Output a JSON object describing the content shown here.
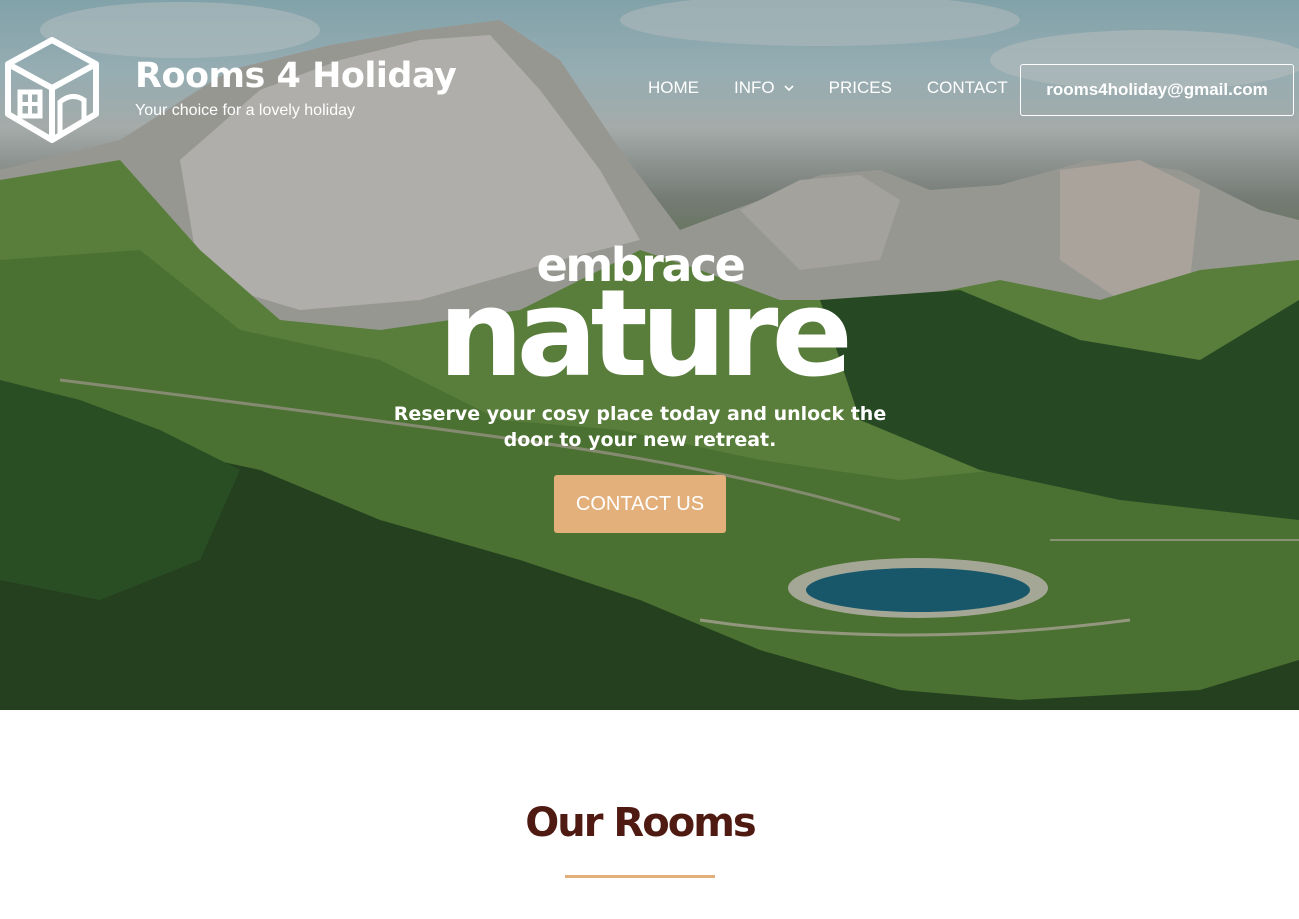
{
  "header": {
    "site_title": "Rooms 4 Holiday",
    "tagline": "Your choice for a lovely holiday",
    "logo_icon": "house-cube-logo",
    "nav": [
      {
        "label": "HOME"
      },
      {
        "label": "INFO",
        "has_dropdown": true
      },
      {
        "label": "PRICES"
      },
      {
        "label": "CONTACT"
      }
    ],
    "email_button": "rooms4holiday@gmail.com"
  },
  "hero": {
    "kicker": "embrace",
    "headline": "nature",
    "subtitle": "Reserve your cosy place today and unlock the door to your new retreat.",
    "cta_label": "CONTACT US",
    "cta_color": "#e3b07c",
    "background": "mountain-landscape-photo"
  },
  "rooms_section": {
    "title": "Our Rooms",
    "title_color": "#4f1a12",
    "divider_color": "#e3b07c"
  }
}
